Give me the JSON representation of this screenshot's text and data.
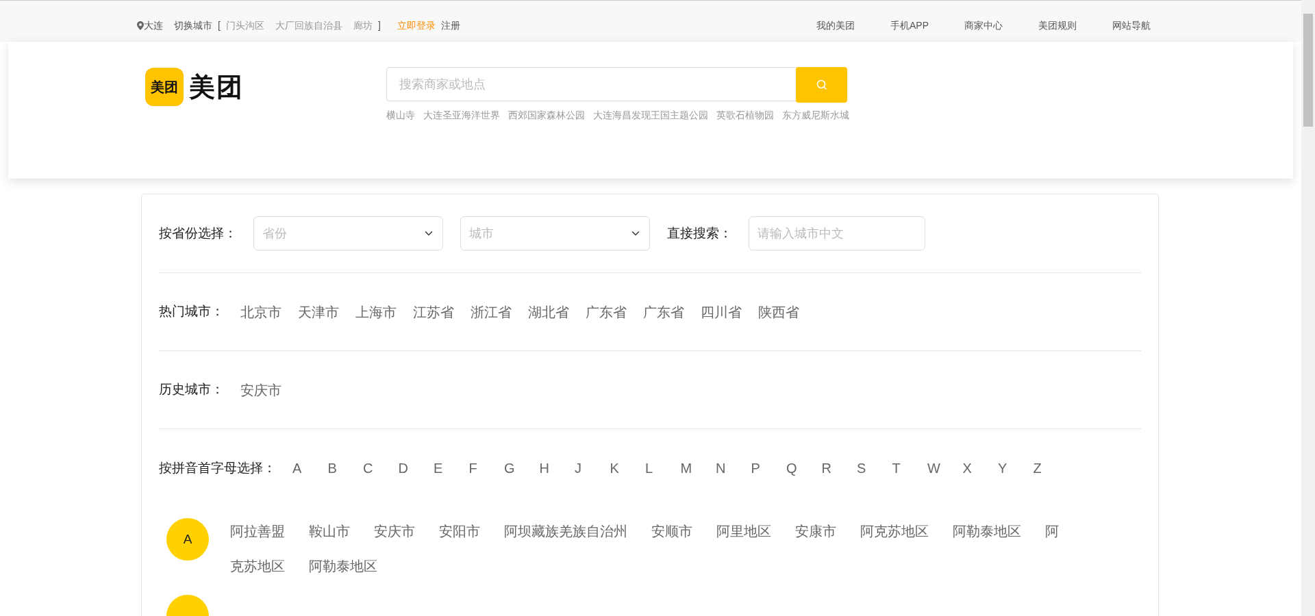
{
  "top_bar": {
    "location": "大连",
    "switch_city": "切换城市",
    "bracket_open": "[",
    "nearby_cities": [
      "门头沟区",
      "大厂回族自治县",
      "廊坊"
    ],
    "bracket_close": "]",
    "login": "立即登录",
    "register": "注册",
    "links": [
      "我的美团",
      "手机APP",
      "商家中心",
      "美团规则",
      "网站导航"
    ]
  },
  "header": {
    "logo_badge": "美团",
    "logo_text": "美团",
    "search": {
      "placeholder": "搜索商家或地点"
    },
    "hot_searches": [
      "横山寺",
      "大连圣亚海洋世界",
      "西郊国家森林公园",
      "大连海昌发现王国主题公园",
      "英歌石植物园",
      "东方威尼斯水城"
    ]
  },
  "selector": {
    "province_label": "按省份选择：",
    "province": {
      "placeholder": "省份"
    },
    "city": {
      "placeholder": "城市"
    },
    "search_label": "直接搜索：",
    "search": {
      "placeholder": "请输入城市中文"
    },
    "hot_label": "热门城市：",
    "hot_cities": [
      "北京市",
      "天津市",
      "上海市",
      "江苏省",
      "浙江省",
      "湖北省",
      "广东省",
      "广东省",
      "四川省",
      "陕西省"
    ],
    "history_label": "历史城市：",
    "history_cities": [
      "安庆市"
    ],
    "pinyin_label": "按拼音首字母选择：",
    "letters": [
      "A",
      "B",
      "C",
      "D",
      "E",
      "F",
      "G",
      "H",
      "J",
      "K",
      "L",
      "M",
      "N",
      "P",
      "Q",
      "R",
      "S",
      "T",
      "W",
      "X",
      "Y",
      "Z"
    ],
    "sections": [
      {
        "letter": "A",
        "cities": [
          "阿拉善盟",
          "鞍山市",
          "安庆市",
          "安阳市",
          "阿坝藏族羌族自治州",
          "安顺市",
          "阿里地区",
          "安康市",
          "阿克苏地区",
          "阿勒泰地区"
        ],
        "wrapped_city": {
          "line_end": "阿",
          "line_start": "克苏地区"
        },
        "more_cities": [
          "阿勒泰地区"
        ]
      }
    ]
  }
}
